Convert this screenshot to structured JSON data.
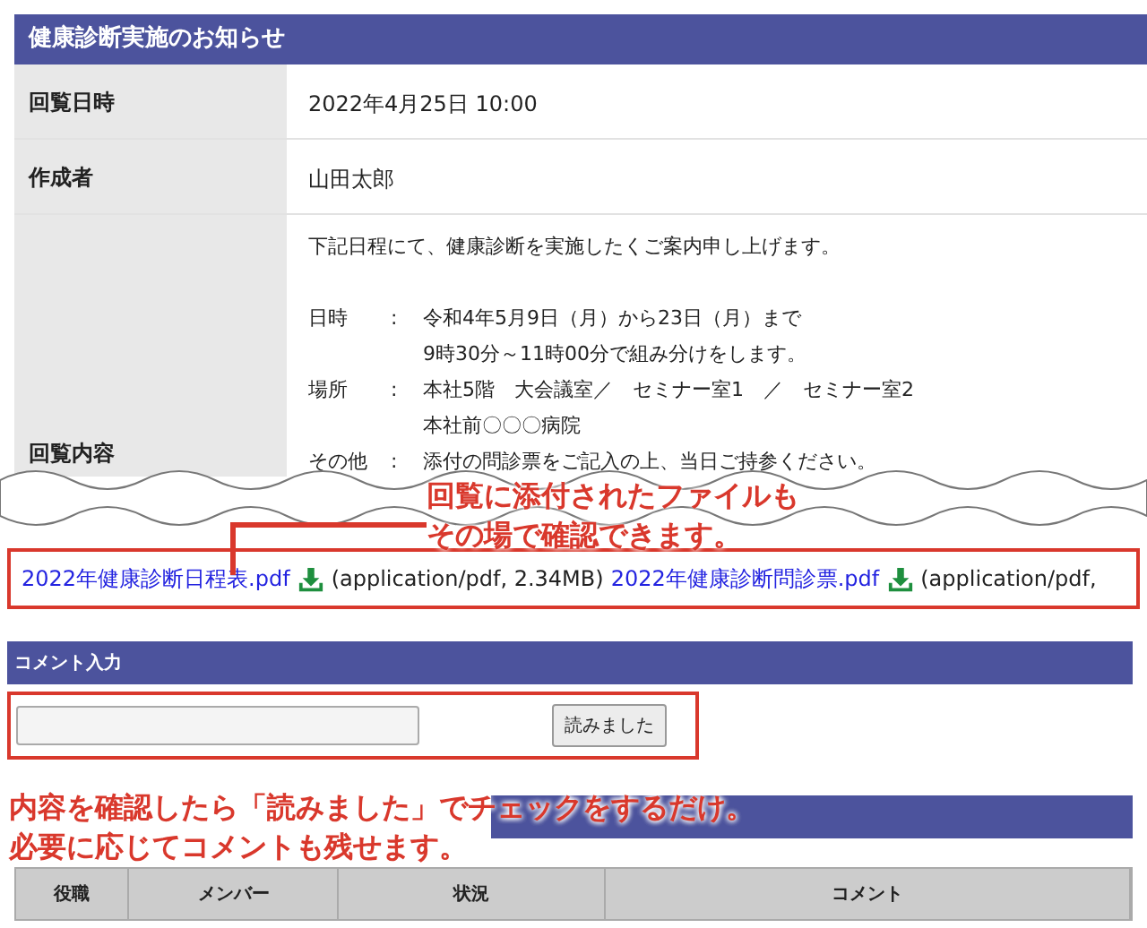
{
  "notice": {
    "title": "健康診断実施のお知らせ",
    "rows": [
      {
        "label": "回覧日時",
        "value": "2022年4月25日 10:00"
      },
      {
        "label": "作成者",
        "value": "山田太郎"
      }
    ],
    "content": {
      "label": "回覧内容",
      "intro": "下記日程にて、健康診断を実施したくご案内申し上げます。",
      "details": [
        {
          "label": "日時",
          "colon": ":",
          "lines": [
            "令和4年5月9日（月）から23日（月）まで",
            "9時30分～11時00分で組み分けをします。"
          ]
        },
        {
          "label": "場所",
          "colon": ":",
          "lines": [
            "本社5階　大会議室／　セミナー室1　／　セミナー室2",
            "本社前〇〇〇病院"
          ]
        },
        {
          "label": "その他",
          "colon": ":",
          "lines": [
            "添付の問診票をご記入の上、当日ご持参ください。"
          ]
        }
      ]
    }
  },
  "attachments": [
    {
      "name": "2022年健康診断日程表.pdf",
      "info": "(application/pdf, 2.34MB)"
    },
    {
      "name": "2022年健康診断問診票.pdf",
      "info": "(application/pdf,"
    }
  ],
  "comment": {
    "title": "コメント入力",
    "button": "読みました"
  },
  "callouts": [
    {
      "lines": [
        "回覧に添付されたファイルも",
        "その場で確認できます。"
      ]
    },
    {
      "lines": [
        "内容を確認したら「読みました」でチェックをするだけ。",
        "必要に応じてコメントも残せます。"
      ]
    }
  ],
  "table": {
    "columns": [
      "役職",
      "メンバー",
      "状況",
      "コメント"
    ]
  }
}
